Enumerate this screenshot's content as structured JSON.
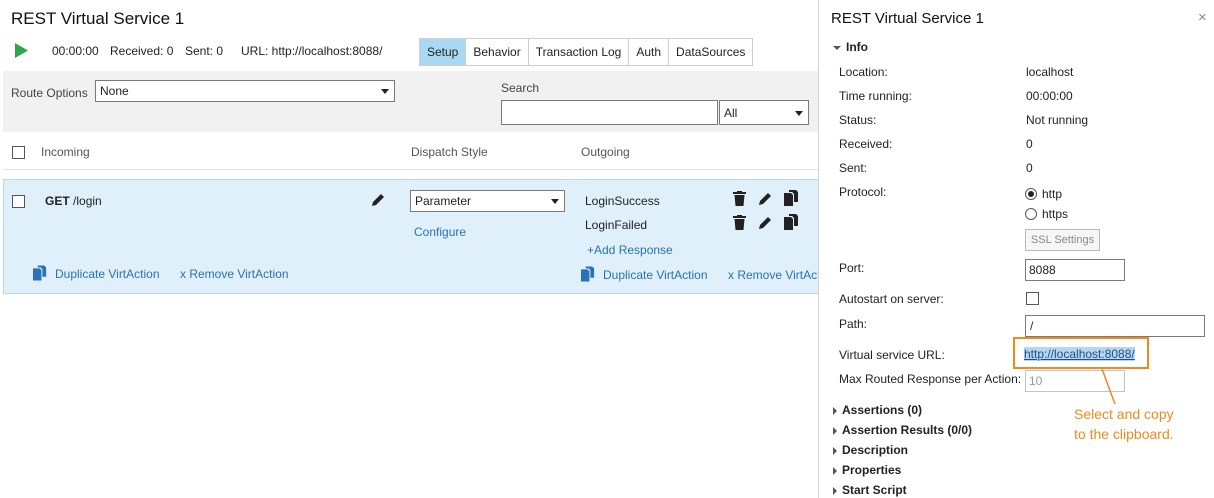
{
  "header": {
    "title": "REST Virtual Service 1",
    "timer": "00:00:00",
    "received": "Received: 0",
    "sent": "Sent: 0",
    "url": "URL: http://localhost:8088/"
  },
  "tabs": [
    {
      "label": "Setup",
      "active": true
    },
    {
      "label": "Behavior"
    },
    {
      "label": "Transaction Log"
    },
    {
      "label": "Auth"
    },
    {
      "label": "DataSources"
    }
  ],
  "filters": {
    "route_options_label": "Route Options",
    "route_options_value": "None",
    "search_label": "Search",
    "search_value": "",
    "search_scope": "All"
  },
  "table": {
    "headers": {
      "incoming": "Incoming",
      "dispatch": "Dispatch Style",
      "outgoing": "Outgoing"
    },
    "row": {
      "method": "GET",
      "path": "/login",
      "dispatch_value": "Parameter",
      "configure": "Configure",
      "responses": [
        "LoginSuccess",
        "LoginFailed"
      ],
      "add_response": "+Add Response",
      "duplicate": "Duplicate VirtAction",
      "remove": "x Remove VirtAction"
    }
  },
  "panel": {
    "title": "REST Virtual Service 1",
    "info_label": "Info",
    "fields": {
      "location_label": "Location:",
      "location_value": "localhost",
      "time_label": "Time running:",
      "time_value": "00:00:00",
      "status_label": "Status:",
      "status_value": "Not running",
      "received_label": "Received:",
      "received_value": "0",
      "sent_label": "Sent:",
      "sent_value": "0",
      "protocol_label": "Protocol:",
      "protocol_http": "http",
      "protocol_https": "https",
      "ssl_button": "SSL Settings",
      "port_label": "Port:",
      "port_value": "8088",
      "autostart_label": "Autostart on server:",
      "path_label": "Path:",
      "path_value": "/",
      "vurl_label": "Virtual service URL:",
      "vurl_value": "http://localhost:8088/",
      "max_label": "Max Routed Response per Action:",
      "max_value": "10"
    },
    "sections": [
      "Assertions (0)",
      "Assertion Results (0/0)",
      "Description",
      "Properties",
      "Start Script"
    ]
  },
  "callout": {
    "line1": "Select and copy",
    "line2": "to the clipboard."
  },
  "colors": {
    "accent": "#a9d8f2",
    "link": "#2a72b5",
    "callout": "#f08a1c",
    "play": "#2ea44f"
  }
}
